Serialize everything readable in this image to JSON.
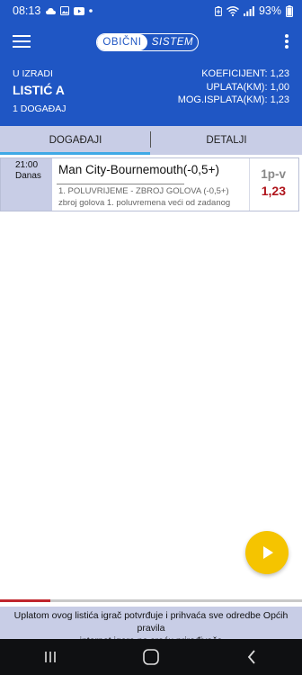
{
  "status_bar": {
    "time": "08:13",
    "battery_percent": "93%",
    "left_icons": [
      "cloud-icon",
      "image-icon",
      "youtube-icon",
      "dot-icon"
    ],
    "right_icons": [
      "battery-saver-icon",
      "wifi-icon",
      "signal-icon",
      "battery-icon"
    ]
  },
  "app_bar": {
    "toggle": {
      "active": "OBIČNI",
      "inactive": "SISTEM"
    },
    "icons": {
      "menu": "menu-icon",
      "more": "more-vert-icon"
    },
    "color": "#1f56c4"
  },
  "ticket": {
    "status": "U IZRADI",
    "name": "LISTIĆ A",
    "event_count": "1 DOGAĐAJ",
    "coefficient": "KOEFICIJENT: 1,23",
    "stake": "UPLATA(KM): 1,00",
    "potential_payout": "MOG.ISPLATA(KM): 1,23"
  },
  "tabs": [
    {
      "label": "DOGAĐAJI",
      "selected": true
    },
    {
      "label": "DETALJI",
      "selected": false
    }
  ],
  "events": [
    {
      "time": "21:00",
      "day": "Danas",
      "match": "Man City-Bournemouth(-0,5+)",
      "bet_type": "1. POLUVRIJEME - ZBROJ GOLOVA (-0,5+)",
      "description": "zbroj golova 1. poluvremena veći od zadanog",
      "mark": "1p-v",
      "odd": "1,23"
    }
  ],
  "fab": {
    "icon": "play-icon",
    "color": "#f5c400"
  },
  "footer": {
    "line1": "Uplatom ovog listića igrač potvrđuje i prihvaća sve odredbe Općih pravila",
    "line2": "internet igara na sreću priređivača"
  },
  "nav_bar": {
    "icons": [
      "recents-icon",
      "home-icon",
      "back-icon"
    ]
  }
}
